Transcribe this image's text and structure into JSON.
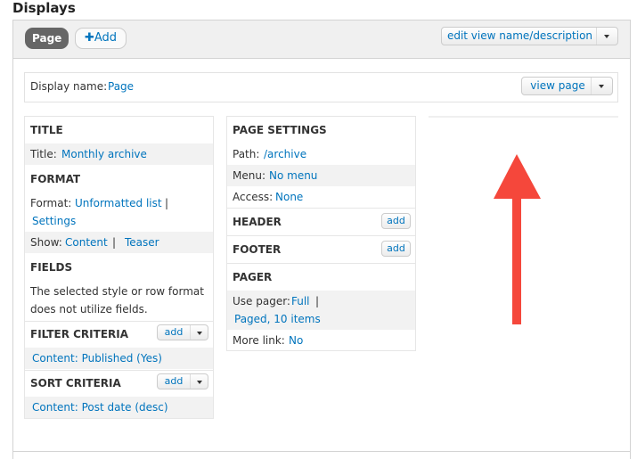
{
  "heading": "Displays",
  "tabs": {
    "active": "Page",
    "add": "Add"
  },
  "edit_view_button": "edit view name/description",
  "display_name": {
    "label": "Display name:",
    "value": "Page",
    "view_button": "view page"
  },
  "column1": {
    "title": {
      "heading": "TITLE",
      "label": "Title:",
      "value": "Monthly archive"
    },
    "format": {
      "heading": "FORMAT",
      "format_label": "Format:",
      "format_value": "Unformatted list",
      "pipe": "|",
      "settings": "Settings",
      "show_label": "Show:",
      "show_value": "Content",
      "show_pipe": "|",
      "show_teaser": "Teaser"
    },
    "fields": {
      "heading": "FIELDS",
      "text_line1": "The selected style or row format",
      "text_line2": "does not utilize fields."
    },
    "filter": {
      "heading": "FILTER CRITERIA",
      "add": "add",
      "item": "Content: Published (Yes)"
    },
    "sort": {
      "heading": "SORT CRITERIA",
      "add": "add",
      "item": "Content: Post date (desc)"
    }
  },
  "column2": {
    "page_settings": {
      "heading": "PAGE SETTINGS",
      "path_label": "Path:",
      "path_value": "/archive",
      "menu_label": "Menu:",
      "menu_value": "No menu",
      "access_label": "Access:",
      "access_value": "None"
    },
    "header": {
      "heading": "HEADER",
      "add": "add"
    },
    "footer": {
      "heading": "FOOTER",
      "add": "add"
    },
    "pager": {
      "heading": "PAGER",
      "use_label": "Use pager:",
      "use_value": "Full",
      "pipe": "|",
      "use_detail": "Paged, 10 items",
      "more_label": "More link:",
      "more_value": "No"
    }
  },
  "colors": {
    "link": "#0074bd",
    "annotation_arrow": "#f5473b",
    "tab_active": "#666666"
  }
}
